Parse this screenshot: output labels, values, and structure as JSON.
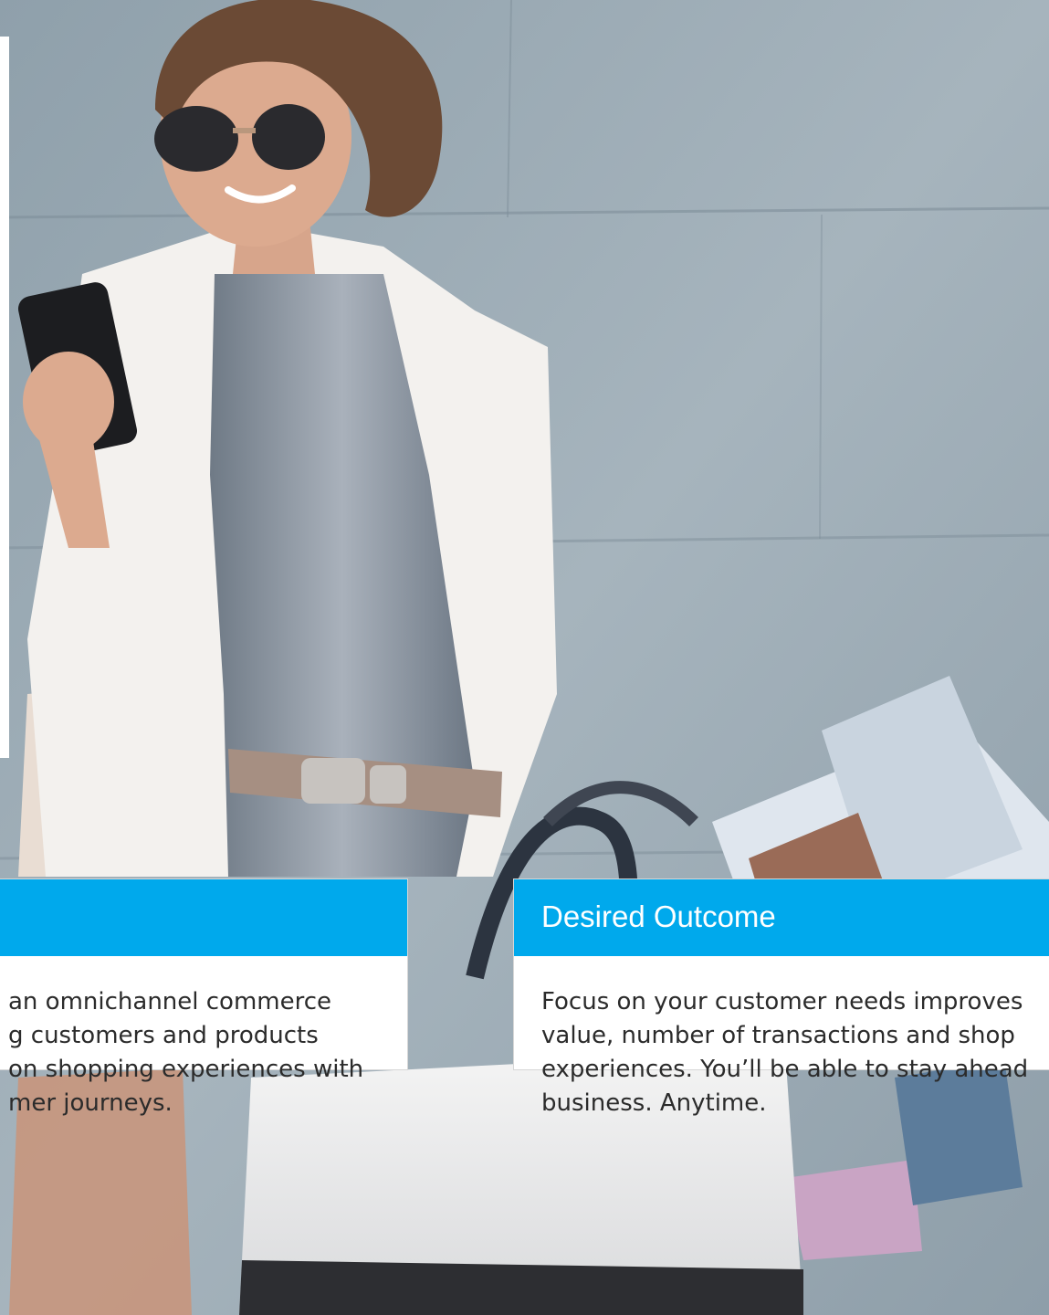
{
  "cards": {
    "left": {
      "title": "",
      "lines": [
        "an omnichannel commerce",
        "g customers and products",
        "on shopping experiences with",
        "mer journeys."
      ]
    },
    "right": {
      "title": "Desired Outcome",
      "lines": [
        "Focus on your customer needs improves",
        "value, number of transactions and shop",
        "experiences. You’ll be able to stay ahead",
        "business. Anytime."
      ]
    }
  },
  "colors": {
    "accent": "#00a9ec",
    "card_background": "#ffffff",
    "body_text": "#2b2b2b",
    "wall": "#9aaab5"
  }
}
